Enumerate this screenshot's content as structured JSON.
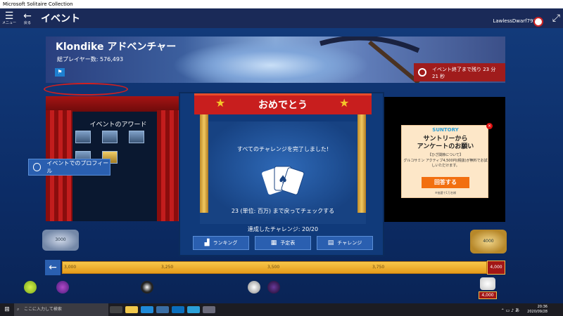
{
  "window": {
    "title": "Microsoft Solitaire Collection"
  },
  "appbar": {
    "menu_label": "メニュー",
    "back_label": "戻る",
    "page_title": "イベント",
    "username": "LawlessDwarf791"
  },
  "banner": {
    "event_title": "Klondike アドベンチャー",
    "total_players": "総プレイヤー数: 576,493",
    "timer_text": "イベント終了まで残り 23 分 21 秒"
  },
  "stage": {
    "awards_title": "イベントのアワード",
    "profile_button": "イベントでのプロフィール"
  },
  "popup": {
    "title": "おめでとう",
    "completed_text": "すべてのチャレンジを完了しました!",
    "units_text": "23 (単位: 百万) まで戻ってチェックする",
    "challenges_completed": "達成したチャレンジ: 20/20",
    "buttons": [
      {
        "label": "ランキング",
        "icon": "podium-icon"
      },
      {
        "label": "予定表",
        "icon": "calendar-icon"
      },
      {
        "label": "チャレンジ",
        "icon": "challenge-icon"
      }
    ]
  },
  "ad": {
    "brand": "SUNTORY",
    "headline": "サントリーから\nアンケートのお願い",
    "subhead": "【ひざ関節について】",
    "promo": "グルコサミン アクティブ4,500円(税抜)が無料でお試しいただけます。",
    "button": "回答する",
    "note": "※抽選で1万名様",
    "close": "×"
  },
  "progress": {
    "tick_labels": [
      "3,000",
      "3,250",
      "3,500",
      "3,750"
    ],
    "end_value": "4,000",
    "goal_value": "4,000",
    "badge_left": "3000",
    "badge_right": "4000"
  },
  "taskbar": {
    "search_placeholder": "ここに入力して検索",
    "time": "20:36",
    "date": "2020/09/28"
  },
  "colors": {
    "accent": "#2a5fb0",
    "ribbon": "#c81e1e",
    "progress": "#f2b535"
  }
}
